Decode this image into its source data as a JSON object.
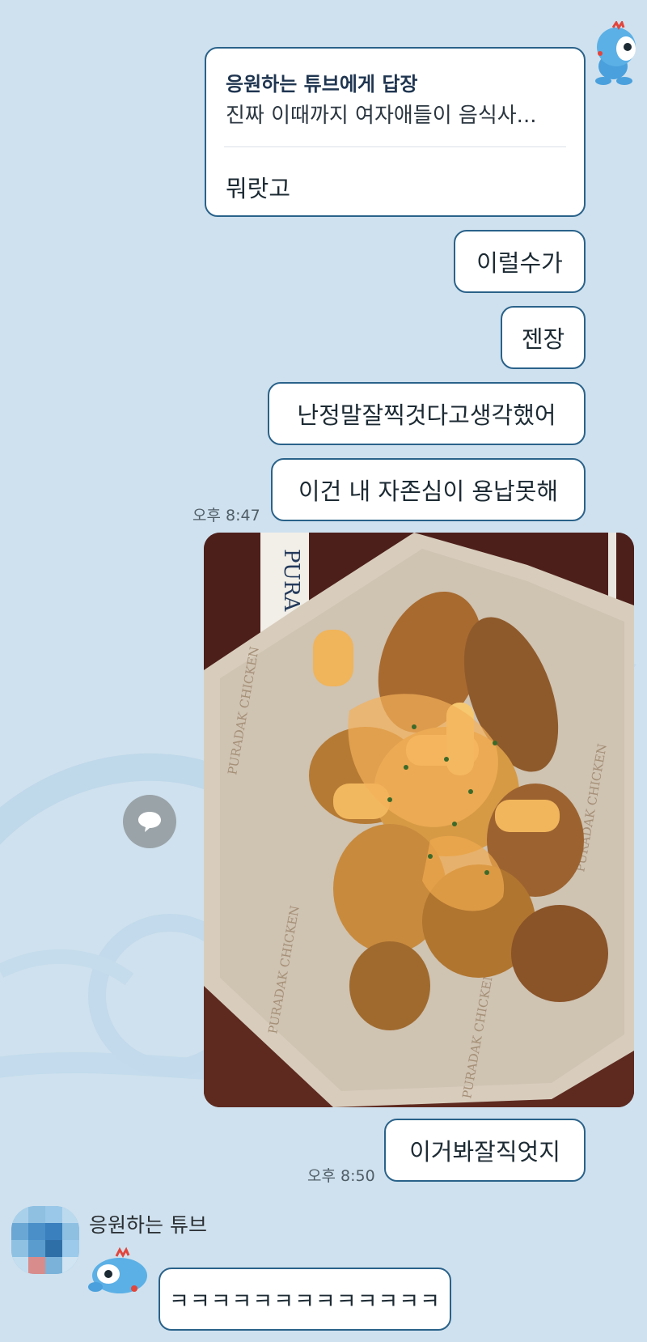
{
  "messages": {
    "reply": {
      "title": "응원하는 튜브에게 답장",
      "quote": "진짜 이때까지 여자애들이 음식사...",
      "body": "뭐랏고"
    },
    "m1": "이럴수가",
    "m2": "젠장",
    "m3": "난정말잘찍것다고생각했어",
    "m4": "이건 내 자존심이 용납못해",
    "time1": "오후 8:47",
    "m5": "이거봐잘직엇지",
    "time2": "오후 8:50"
  },
  "photo": {
    "wrapper_text": "PURADAK CHICKEN",
    "box_text": "PURA"
  },
  "incoming": {
    "sender": "응원하는 튜브",
    "text": "ㅋㅋㅋㅋㅋㅋㅋㅋㅋㅋㅋㅋㅋ"
  },
  "icons": {
    "mascot": "tube-duck-mascot-icon",
    "share": "speech-bubble-icon"
  },
  "colors": {
    "background": "#cfe1ee",
    "bubble_border": "#2a628a",
    "bubble_fill": "#ffffff"
  }
}
